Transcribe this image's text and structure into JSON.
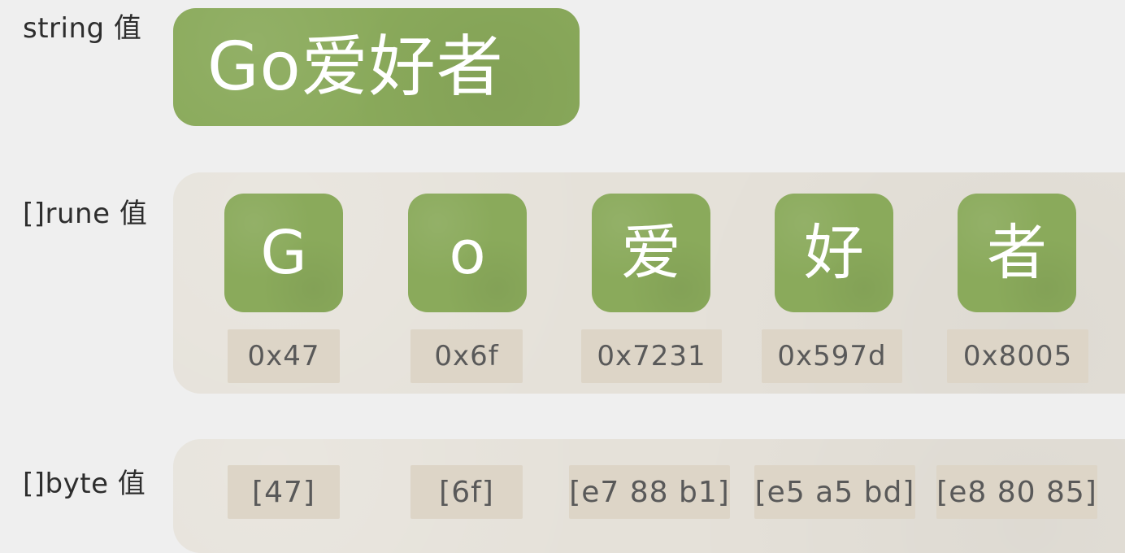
{
  "labels": {
    "string": "string 值",
    "rune": "[]rune 值",
    "byte": "[]byte 值"
  },
  "string_value": "Go爱好者",
  "rune_values": [
    "G",
    "o",
    "爱",
    "好",
    "者"
  ],
  "rune_hex": [
    "0x47",
    "0x6f",
    "0x7231",
    "0x597d",
    "0x8005"
  ],
  "byte_values": [
    "[47]",
    "[6f]",
    "[e7 88 b1]",
    "[e5 a5 bd]",
    "[e8 80 85]"
  ],
  "colors": {
    "background": "#efefef",
    "green": "#8aaa5b",
    "panel": "#e5e1d9",
    "cell": "#ddd5c7",
    "text": "#595959"
  }
}
